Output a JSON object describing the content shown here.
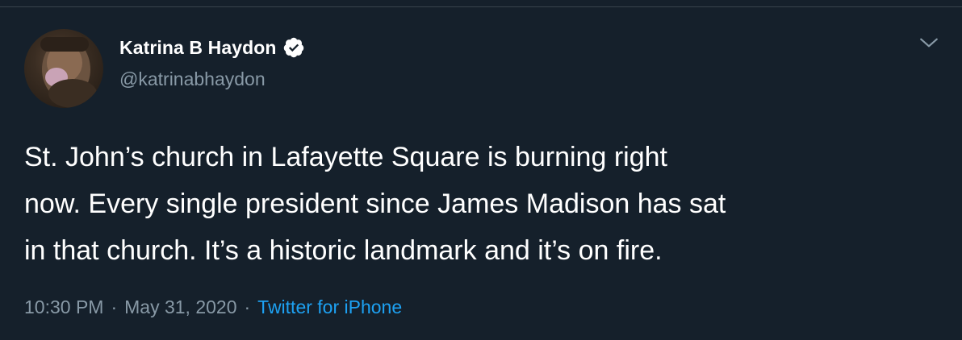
{
  "author": {
    "name": "Katrina B Haydon",
    "handle": "@katrinabhaydon",
    "verified": true,
    "avatar_icon": "profile-photo"
  },
  "menu_icon": "chevron-down-icon",
  "tweet": {
    "text": "St. John’s church in Lafayette Square is burning right\nnow. Every single president since James Madison has sat\nin that church. It’s a historic landmark and it’s on fire."
  },
  "meta": {
    "time": "10:30 PM",
    "separator": "·",
    "date": "May 31, 2020",
    "source": "Twitter for iPhone"
  },
  "colors": {
    "background": "#15202b",
    "primary_text": "#ffffff",
    "secondary_text": "#8899a6",
    "link": "#1da1f2",
    "divider": "#38444d"
  }
}
